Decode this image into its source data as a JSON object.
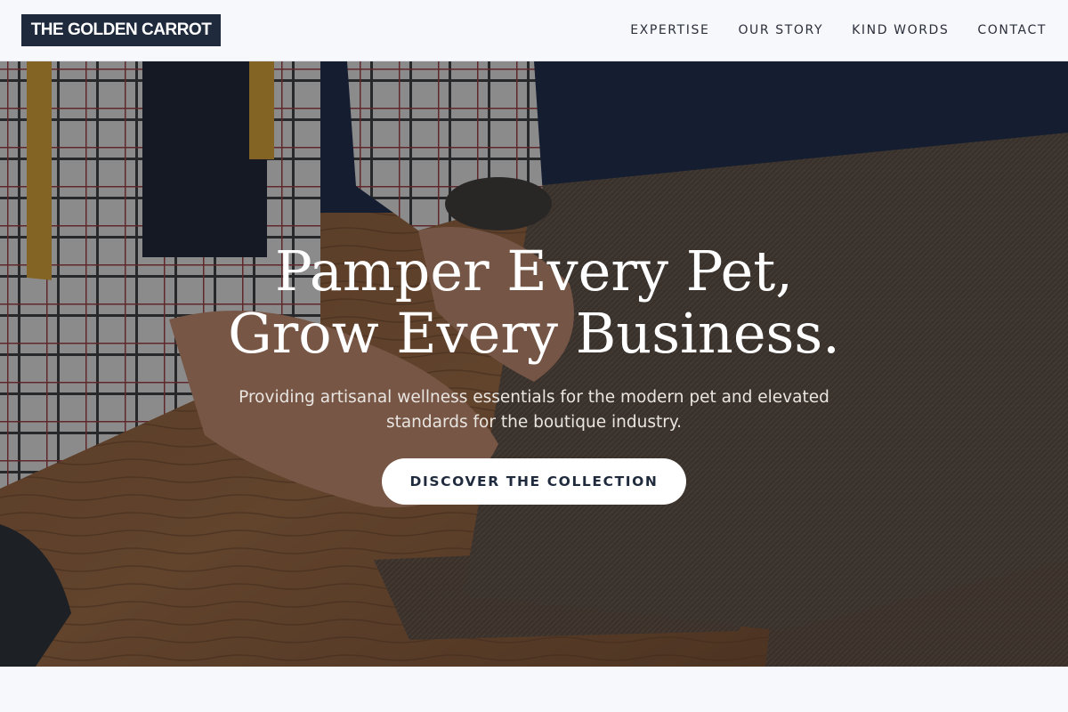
{
  "brand": {
    "logo_text": "THE GOLDEN CARROT"
  },
  "nav": {
    "items": [
      {
        "label": "EXPERTISE"
      },
      {
        "label": "OUR STORY"
      },
      {
        "label": "KIND WORDS"
      },
      {
        "label": "CONTACT"
      }
    ]
  },
  "hero": {
    "title_line1": "Pamper Every Pet,",
    "title_line2": "Grow Every Business.",
    "subtitle_line1": "Providing artisanal wellness essentials for the modern pet and elevated",
    "subtitle_line2": "standards for the boutique industry.",
    "cta_label": "DISCOVER THE COLLECTION",
    "background_icon": "tailor-cutting-fabric-photo"
  },
  "colors": {
    "logo_bg": "#1f2a3d",
    "page_bg": "#f7f8fc",
    "cta_bg": "#ffffff",
    "cta_text": "#1f2a3d"
  }
}
